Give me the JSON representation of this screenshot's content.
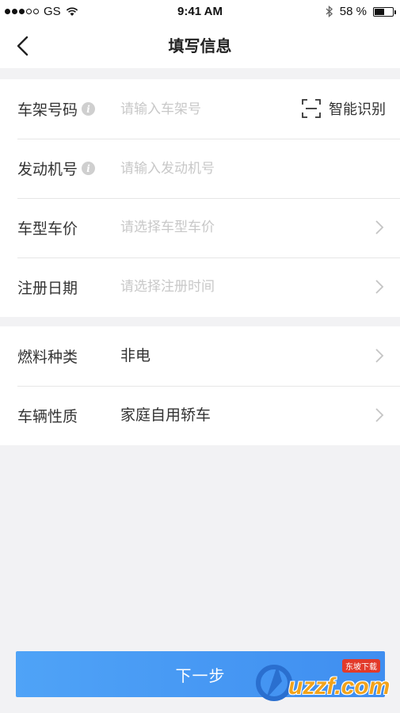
{
  "status_bar": {
    "carrier": "GS",
    "time": "9:41 AM",
    "battery_text": "58 %",
    "battery_level": 0.58,
    "signal_bars": 3,
    "signal_total": 5
  },
  "nav": {
    "title": "填写信息",
    "back_icon": "chevron-left-icon"
  },
  "form_group_1": [
    {
      "label": "车架号码",
      "has_info": true,
      "placeholder": "请输入车架号",
      "type": "input",
      "action_label": "智能识别",
      "action_icon": "scan-frame-icon"
    },
    {
      "label": "发动机号",
      "has_info": true,
      "placeholder": "请输入发动机号",
      "type": "input"
    },
    {
      "label": "车型车价",
      "has_info": false,
      "placeholder": "请选择车型车价",
      "type": "select"
    },
    {
      "label": "注册日期",
      "has_info": false,
      "placeholder": "请选择注册时间",
      "type": "select"
    }
  ],
  "form_group_2": [
    {
      "label": "燃料种类",
      "value": "非电",
      "type": "select"
    },
    {
      "label": "车辆性质",
      "value": "家庭自用轿车",
      "type": "select"
    }
  ],
  "footer": {
    "next_button_label": "下一步"
  },
  "watermark": {
    "text": "uzzf.com",
    "badge": "东坡下载"
  },
  "colors": {
    "accent": "#4a9cf5",
    "background": "#f2f2f4",
    "placeholder": "#c8c8c8",
    "watermark_orange": "#f2a31b"
  }
}
